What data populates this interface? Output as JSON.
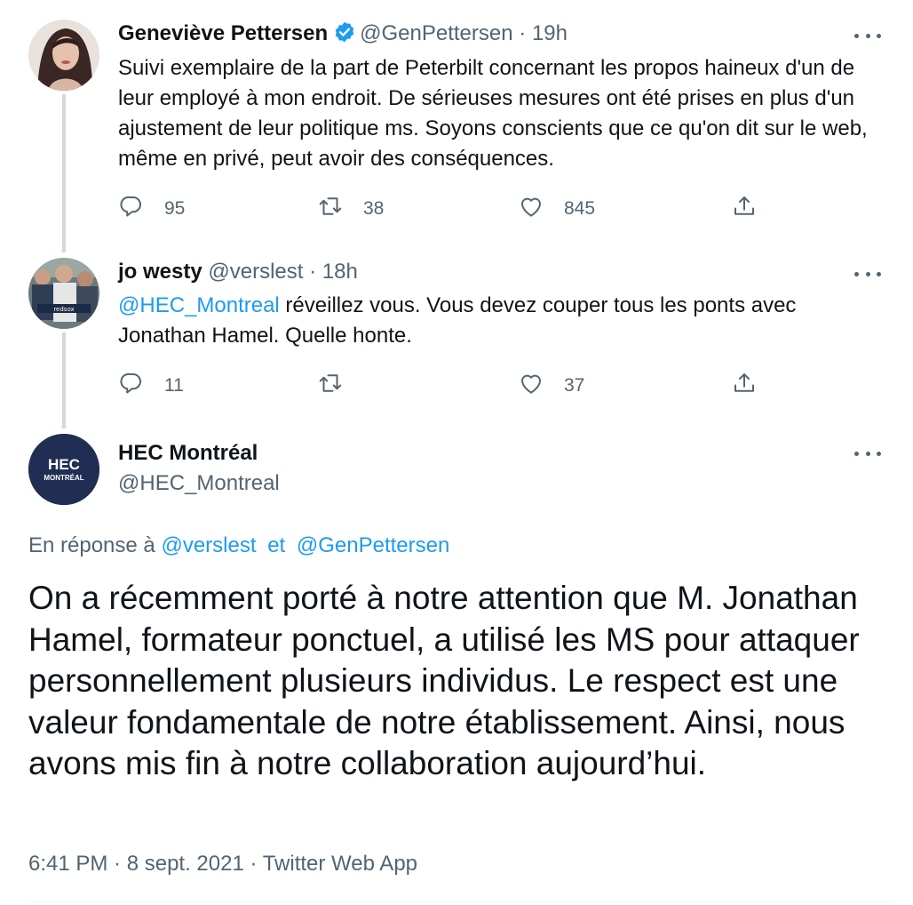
{
  "thread": [
    {
      "author": "Geneviève Pettersen",
      "verified": true,
      "handle": "@GenPettersen",
      "separator": "·",
      "time": "19h",
      "text": "Suivi exemplaire de la part de Peterbilt concernant les propos haineux d'un de leur employé à mon endroit. De sérieuses mesures ont été prises en plus d'un ajustement de leur politique ms. Soyons conscients que ce qu'on dit sur le web, même en privé, peut avoir des conséquences.",
      "replies": "95",
      "retweets": "38",
      "likes": "845"
    },
    {
      "author": "jo westy",
      "handle": "@verslest",
      "separator": "·",
      "time": "18h",
      "mention": "@HEC_Montreal",
      "text": " réveillez vous. Vous devez couper  tous les ponts avec Jonathan Hamel. Quelle honte.",
      "replies": "11",
      "retweets": "",
      "likes": "37"
    }
  ],
  "main_tweet": {
    "author": "HEC Montréal",
    "handle": "@HEC_Montreal",
    "avatar_logo_top": "HEC",
    "avatar_logo_bottom": "MONTRÉAL",
    "reply_prefix": "En réponse à",
    "reply_mention_1": "@verslest",
    "reply_joiner": "et",
    "reply_mention_2": "@GenPettersen",
    "text": "On a récemment porté à notre attention que M. Jonathan Hamel, formateur ponctuel, a utilisé les MS pour attaquer personnellement plusieurs individus. Le respect est une valeur fondamentale de notre établissement. Ainsi, nous avons mis fin à notre collaboration aujourd’hui.",
    "timestamp": "6:41 PM · 8 sept. 2021 · Twitter Web App"
  },
  "icons": {
    "reply": "reply-icon",
    "retweet": "retweet-icon",
    "like": "heart-icon",
    "share": "share-icon",
    "more": "more-icon",
    "verified": "verified-badge-icon"
  },
  "colors": {
    "accent": "#1d9bf0",
    "secondary_text": "#536471",
    "hec_navy": "#1f2e52"
  }
}
